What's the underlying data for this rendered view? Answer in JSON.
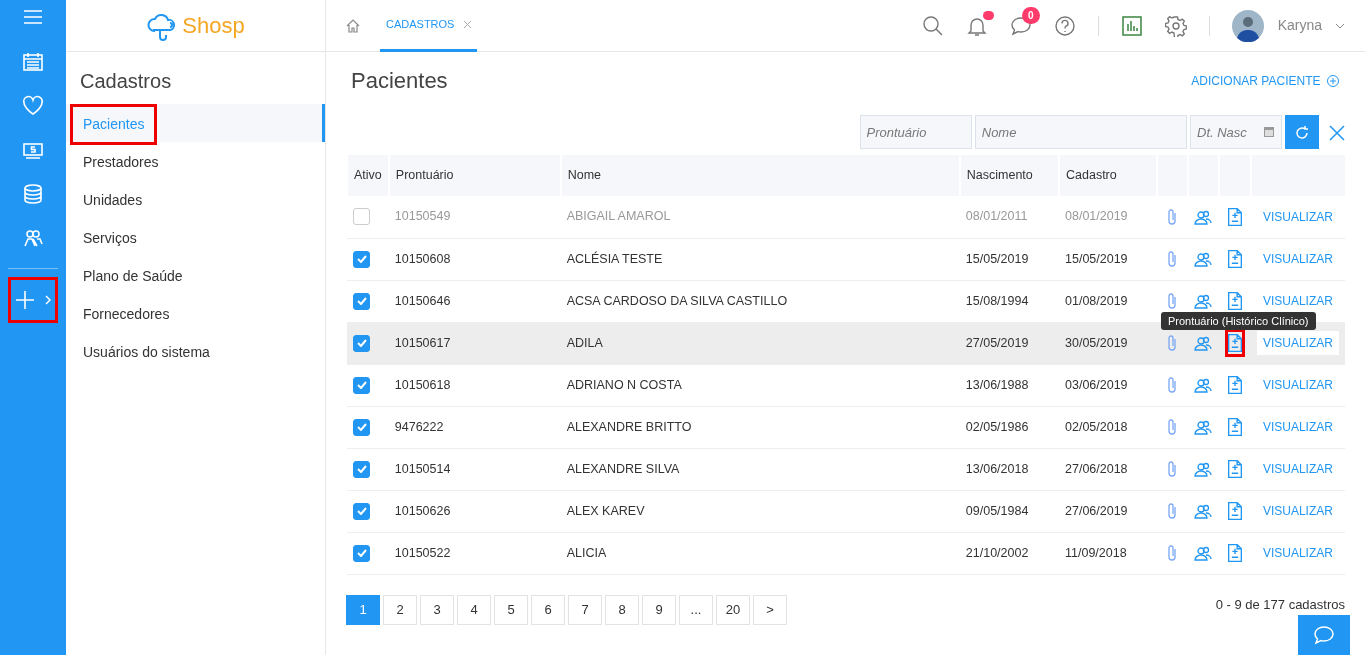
{
  "rail": {
    "items": [
      {
        "kind": "calendar"
      },
      {
        "kind": "heart"
      },
      {
        "kind": "money"
      },
      {
        "kind": "database"
      },
      {
        "kind": "people"
      }
    ],
    "add": {
      "highlighted": true
    }
  },
  "logo": {
    "text": "Shosp"
  },
  "sidebar": {
    "title": "Cadastros",
    "items": [
      {
        "label": "Pacientes",
        "selected": true,
        "highlighted": true
      },
      {
        "label": "Prestadores",
        "selected": false,
        "highlighted": false
      },
      {
        "label": "Unidades",
        "selected": false,
        "highlighted": false
      },
      {
        "label": "Serviços",
        "selected": false,
        "highlighted": false
      },
      {
        "label": "Plano de Saúde",
        "selected": false,
        "highlighted": false
      },
      {
        "label": "Fornecedores",
        "selected": false,
        "highlighted": false
      },
      {
        "label": "Usuários do sistema",
        "selected": false,
        "highlighted": false
      }
    ]
  },
  "tabs": [
    {
      "label": "CADASTROS",
      "selected": true
    }
  ],
  "topbar": {
    "messages_count": "0",
    "notification_unread": true,
    "user": "Karyna"
  },
  "page": {
    "title": "Pacientes",
    "add_label": "ADICIONAR PACIENTE"
  },
  "filters": [
    {
      "placeholder": "Prontuário",
      "kind": "text"
    },
    {
      "placeholder": "Nome",
      "kind": "text"
    },
    {
      "placeholder": "Dt. Nasc",
      "kind": "date"
    }
  ],
  "table": {
    "columns": [
      "Ativo",
      "Prontuário",
      "Nome",
      "Nascimento",
      "Cadastro"
    ],
    "rows": [
      {
        "active": false,
        "prontuario": "10150549",
        "nome": "ABIGAIL AMAROL",
        "nascimento": "08/01/2011",
        "cadastro": "08/01/2019",
        "action": "VISUALIZAR",
        "hovered": false,
        "record_highlighted": false
      },
      {
        "active": true,
        "prontuario": "10150608",
        "nome": "ACLÉSIA TESTE",
        "nascimento": "15/05/2019",
        "cadastro": "15/05/2019",
        "action": "VISUALIZAR",
        "hovered": false,
        "record_highlighted": false
      },
      {
        "active": true,
        "prontuario": "10150646",
        "nome": "ACSA CARDOSO DA SILVA CASTILLO",
        "nascimento": "15/08/1994",
        "cadastro": "01/08/2019",
        "action": "VISUALIZAR",
        "hovered": false,
        "record_highlighted": false
      },
      {
        "active": true,
        "prontuario": "10150617",
        "nome": "ADILA",
        "nascimento": "27/05/2019",
        "cadastro": "30/05/2019",
        "action": "VISUALIZAR",
        "hovered": true,
        "record_highlighted": true,
        "tooltip": "Prontuário (Histórico Clínico)"
      },
      {
        "active": true,
        "prontuario": "10150618",
        "nome": "ADRIANO N COSTA",
        "nascimento": "13/06/1988",
        "cadastro": "03/06/2019",
        "action": "VISUALIZAR",
        "hovered": false,
        "record_highlighted": false
      },
      {
        "active": true,
        "prontuario": "9476222",
        "nome": "ALEXANDRE BRITTO",
        "nascimento": "02/05/1986",
        "cadastro": "02/05/2018",
        "action": "VISUALIZAR",
        "hovered": false,
        "record_highlighted": false
      },
      {
        "active": true,
        "prontuario": "10150514",
        "nome": "ALEXANDRE SILVA",
        "nascimento": "13/06/2018",
        "cadastro": "27/06/2018",
        "action": "VISUALIZAR",
        "hovered": false,
        "record_highlighted": false
      },
      {
        "active": true,
        "prontuario": "10150626",
        "nome": "ALEX KAREV",
        "nascimento": "09/05/1984",
        "cadastro": "27/06/2019",
        "action": "VISUALIZAR",
        "hovered": false,
        "record_highlighted": false
      },
      {
        "active": true,
        "prontuario": "10150522",
        "nome": "ALICIA",
        "nascimento": "21/10/2002",
        "cadastro": "11/09/2018",
        "action": "VISUALIZAR",
        "hovered": false,
        "record_highlighted": false
      }
    ]
  },
  "pagination": {
    "pages": [
      {
        "label": "1",
        "selected": true
      },
      {
        "label": "2",
        "selected": false
      },
      {
        "label": "3",
        "selected": false
      },
      {
        "label": "4",
        "selected": false
      },
      {
        "label": "5",
        "selected": false
      },
      {
        "label": "6",
        "selected": false
      },
      {
        "label": "7",
        "selected": false
      },
      {
        "label": "8",
        "selected": false
      },
      {
        "label": "9",
        "selected": false
      },
      {
        "label": "...",
        "selected": false
      },
      {
        "label": "20",
        "selected": false
      },
      {
        "label": ">",
        "selected": false
      }
    ],
    "summary": "0 - 9 de 177 cadastros"
  }
}
